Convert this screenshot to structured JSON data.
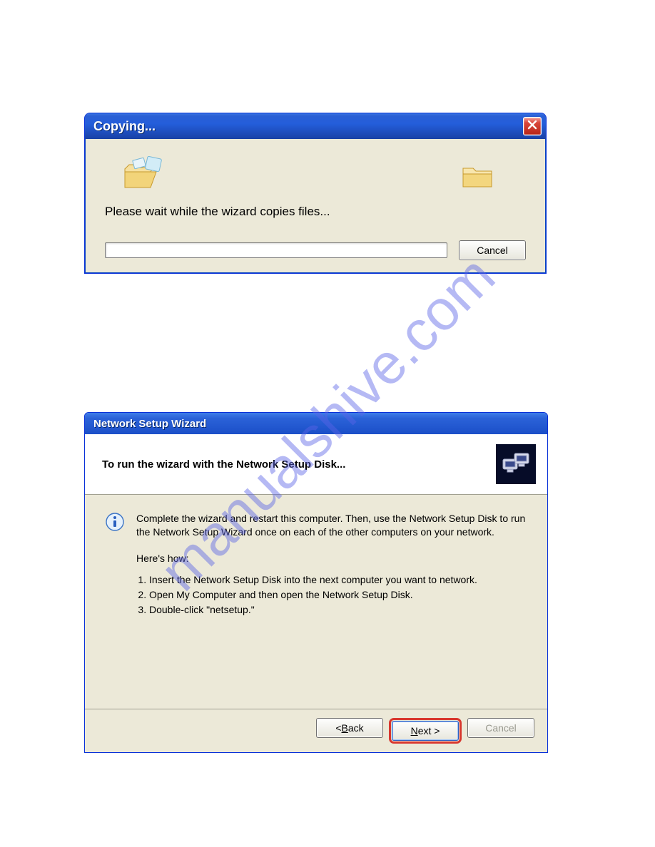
{
  "watermark": "manualshive.com",
  "copying": {
    "title": "Copying...",
    "wait_text": "Please wait while the wizard copies files...",
    "cancel_label": "Cancel"
  },
  "wizard": {
    "title": "Network Setup Wizard",
    "header_text": "To run the wizard with the Network Setup Disk...",
    "info_text": "Complete the wizard and restart this computer. Then, use the Network Setup Disk to run the Network Setup Wizard once on each of the other computers on your network.",
    "heres_how": "Here's how:",
    "steps": [
      "Insert the Network Setup Disk into the next computer you want to network.",
      "Open My Computer and then open the Network Setup Disk.",
      "Double-click \"netsetup.\""
    ],
    "back_label": "Back",
    "next_label": "Next",
    "cancel_label": "Cancel"
  }
}
